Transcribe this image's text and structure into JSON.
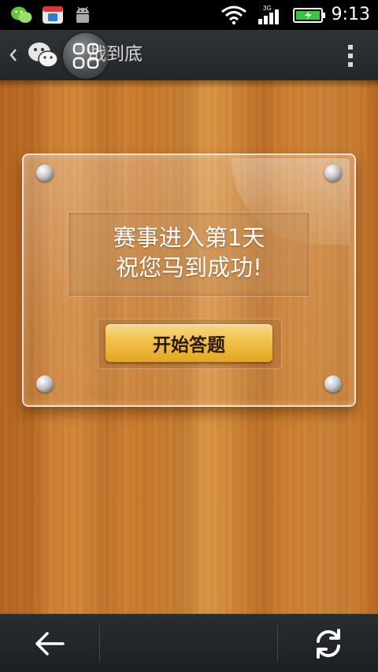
{
  "status_bar": {
    "time": "9:13",
    "network_label": "3G",
    "icons": [
      "wechat-icon",
      "store-icon",
      "android-icon",
      "wifi-icon",
      "signal-icon",
      "battery-icon"
    ]
  },
  "app_bar": {
    "title": "战到底",
    "icons": [
      "back-chevron-icon",
      "wechat-icon",
      "grid-icon",
      "more-vertical-icon"
    ]
  },
  "card": {
    "line1": "赛事进入第1天",
    "line2": "祝您马到成功!",
    "start_button_label": "开始答题"
  },
  "bottom_nav": {
    "icons": [
      "back-arrow-icon",
      "refresh-icon"
    ]
  },
  "colors": {
    "button_gold": "#f1c24e",
    "wood": "#d4883a",
    "battery_green": "#3cc43c",
    "bar_dark": "#23272a"
  }
}
